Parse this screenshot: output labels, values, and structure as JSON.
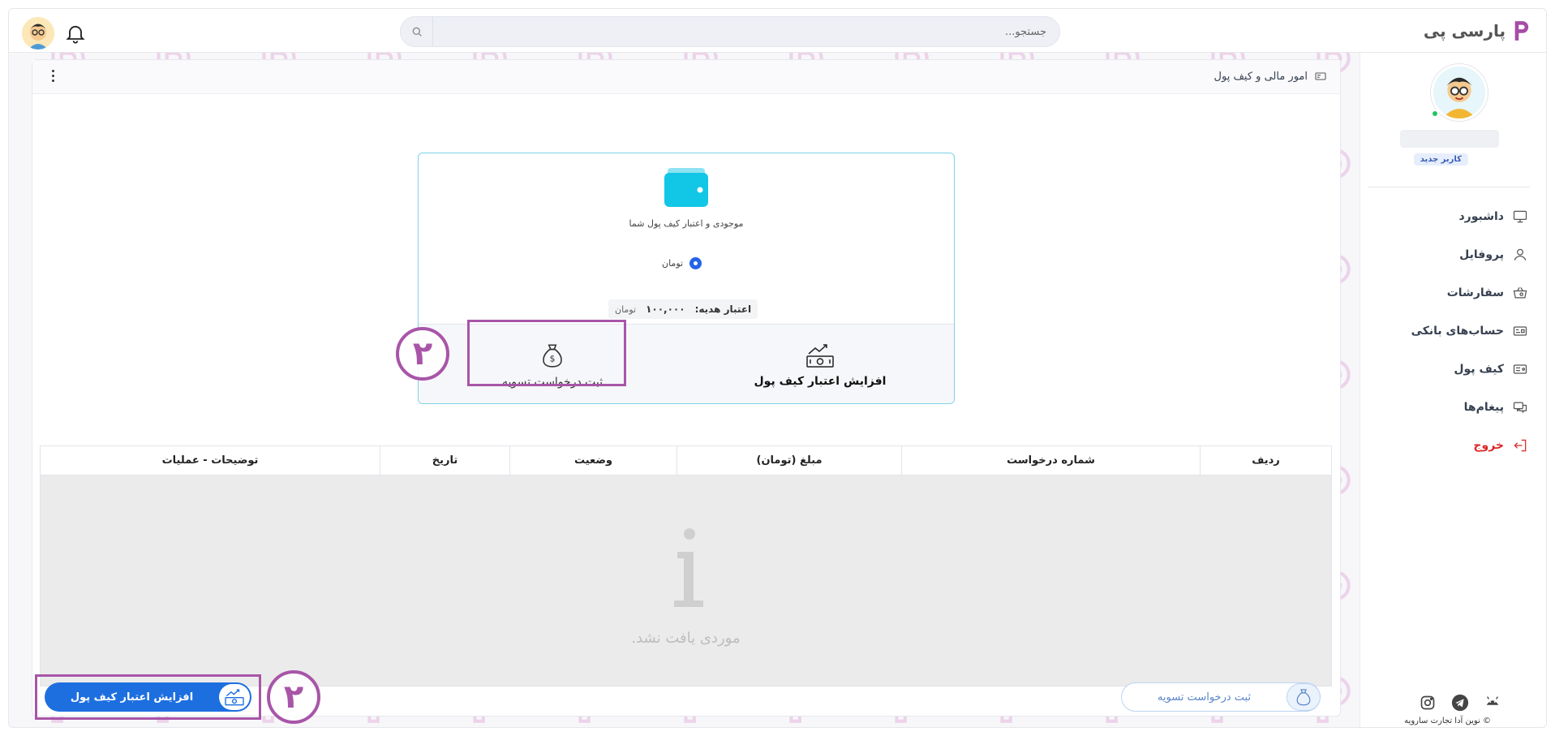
{
  "brand": {
    "name": "پارسی پی"
  },
  "search": {
    "placeholder": "جستجو..."
  },
  "user": {
    "badge": "کاربر جدید"
  },
  "sidebar": {
    "items": [
      {
        "label": "داشبورد",
        "icon": "monitor-icon"
      },
      {
        "label": "پروفایل",
        "icon": "user-icon"
      },
      {
        "label": "سفارشات",
        "icon": "basket-icon"
      },
      {
        "label": "حساب‌های بانکی",
        "icon": "bank-card-icon"
      },
      {
        "label": "کیف پول",
        "icon": "wallet-icon"
      },
      {
        "label": "پیغام‌ها",
        "icon": "messages-icon"
      },
      {
        "label": "خروج",
        "icon": "logout-icon"
      }
    ],
    "social": [
      "instagram-icon",
      "telegram-icon",
      "android-icon"
    ],
    "copyright": "© نوین آدا تجارت سارویه"
  },
  "panel": {
    "title": "امور مالی و کیف پول"
  },
  "wallet": {
    "description": "موجودی و اعتبار کیف پول شما",
    "currency": "تومان",
    "gift_label": "اعتبار هدیه:",
    "gift_value": "۱۰۰,۰۰۰",
    "gift_unit": "تومان",
    "action_settle": "ثبت درخواست  تسویه",
    "action_credit": "افزایش اعتبار  کیف پول"
  },
  "annotations": {
    "step_number": "۲"
  },
  "table": {
    "headers": [
      "ردیف",
      "شماره درخواست",
      "مبلغ (تومان)",
      "وضعیت",
      "تاریخ",
      "توضیحات - عملیات"
    ],
    "empty_text": "موردی یافت نشد."
  },
  "footer_buttons": {
    "credit": "افزایش اعتبار  کیف پول",
    "settle": "ثبت درخواست  تسویه"
  },
  "colors": {
    "accent_blue": "#1d6fe0",
    "highlight_purple": "#a855a8",
    "brand_purple": "#a64ca6",
    "wallet_cyan": "#12c6e6",
    "logout_red": "#dc2626"
  }
}
